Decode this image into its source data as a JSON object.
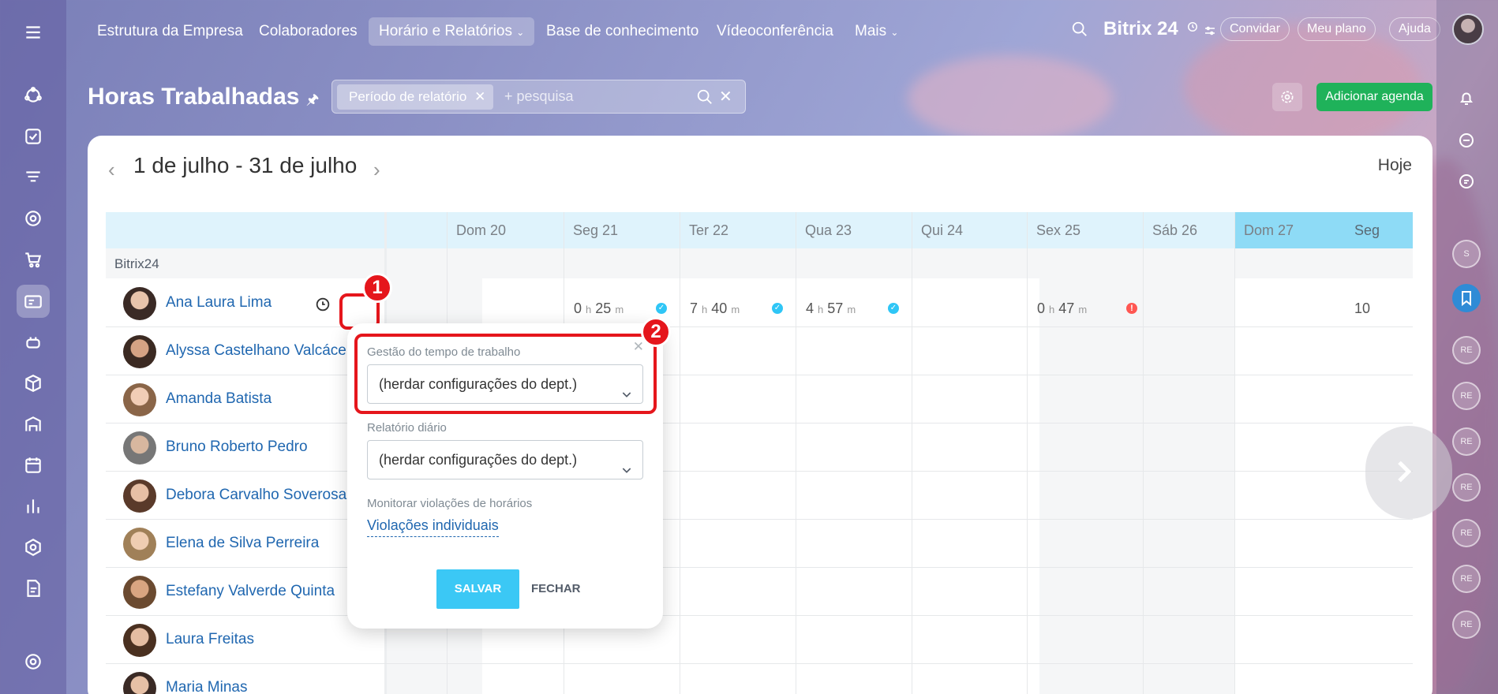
{
  "topnav": {
    "menu_icon": "hamburger-icon",
    "items": [
      "Estrutura da Empresa",
      "Colaboradores",
      "Horário e Relatórios",
      "Base de conhecimento",
      "Vídeoconferência",
      "Mais"
    ],
    "active_index": 2,
    "brand": "Bitrix 24",
    "invite": "Convidar",
    "plan": "Meu plano",
    "help": "Ajuda"
  },
  "page": {
    "title": "Horas Trabalhadas",
    "filter_tag": "Período de relatório",
    "search_placeholder": "+ pesquisa",
    "add_button": "Adicionar agenda"
  },
  "calendar": {
    "period": "1 de julho - 31 de julho",
    "today": "Hoje",
    "days": [
      "Dom 20",
      "Seg 21",
      "Ter 22",
      "Qua 23",
      "Qui 24",
      "Sex 25",
      "Sáb 26",
      "Dom 27",
      "Seg"
    ],
    "department": "Bitrix24",
    "employees": [
      "Ana Laura Lima",
      "Alyssa Castelhano Valcácer",
      "Amanda Batista",
      "Bruno Roberto Pedro",
      "Debora Carvalho Soverosa",
      "Elena de Silva Perreira",
      "Estefany Valverde Quinta",
      "Laura Freitas",
      "Maria Minas"
    ],
    "times": [
      {
        "h": "0",
        "hu": "h",
        "m": "25",
        "mu": "m",
        "status": "ok"
      },
      {
        "h": "7",
        "hu": "h",
        "m": "40",
        "mu": "m",
        "status": "ok"
      },
      {
        "h": "4",
        "hu": "h",
        "m": "57",
        "mu": "m",
        "status": "ok"
      },
      {
        "h": "0",
        "hu": "h",
        "m": "47",
        "mu": "m",
        "status": "error"
      }
    ],
    "partial_time": "10"
  },
  "popup": {
    "label1": "Gestão do tempo de trabalho",
    "value1": "(herdar configurações do dept.)",
    "label2": "Relatório diário",
    "value2": "(herdar configurações do dept.)",
    "label3": "Monitorar violações de horários",
    "link": "Violações individuais",
    "save": "SALVAR",
    "close": "FECHAR"
  },
  "badges": {
    "first": "1",
    "second": "2"
  },
  "rightbar": {
    "avatars": [
      "S",
      "RE",
      "RE",
      "RE",
      "RE",
      "RE",
      "RE",
      "RE"
    ]
  },
  "colors": {
    "accent": "#3bc8f5",
    "add_button": "#1fb25a",
    "highlight": "#e5161c",
    "link": "#2067b0"
  }
}
